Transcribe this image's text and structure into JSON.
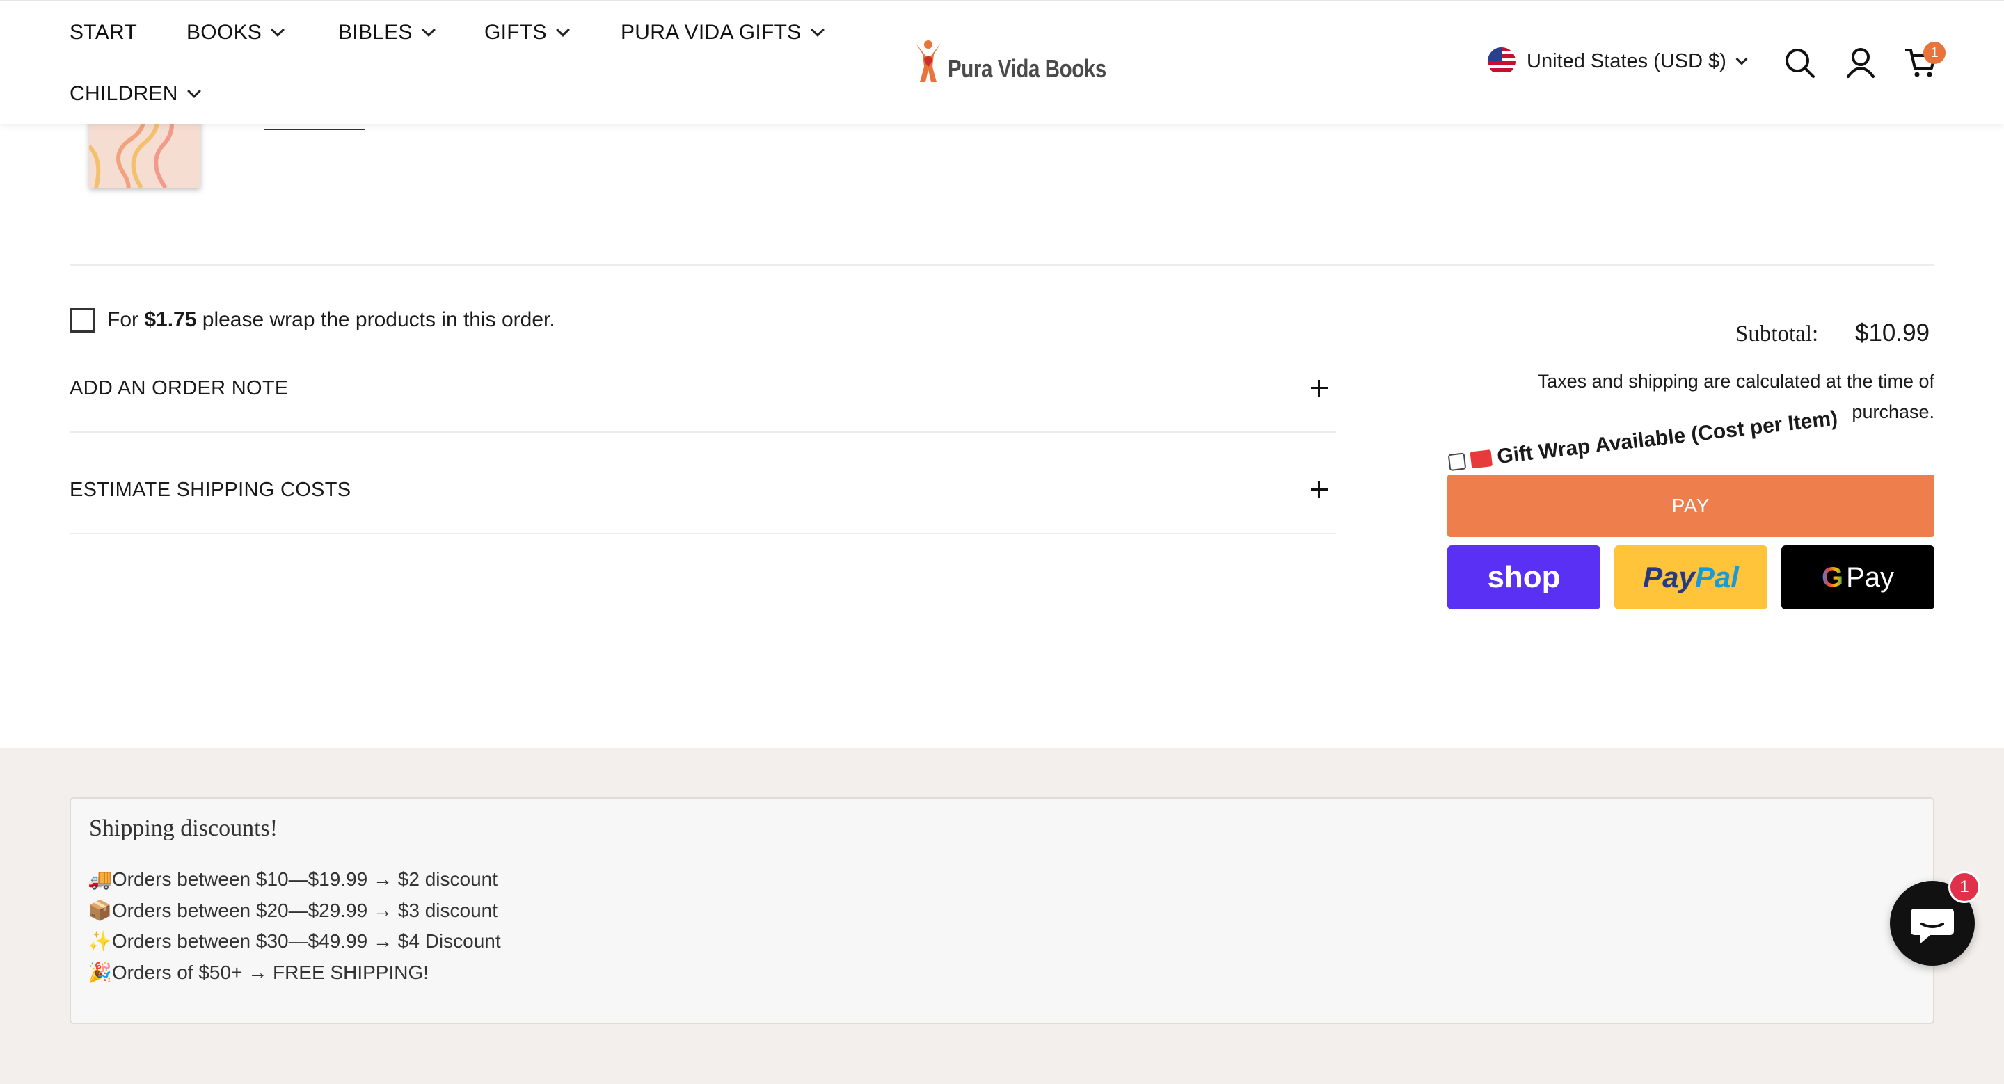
{
  "header": {
    "nav": [
      {
        "label": "START",
        "has_dropdown": false
      },
      {
        "label": "BOOKS",
        "has_dropdown": true
      },
      {
        "label": "BIBLES",
        "has_dropdown": true
      },
      {
        "label": "GIFTS",
        "has_dropdown": true
      },
      {
        "label": "PURA VIDA GIFTS",
        "has_dropdown": true
      },
      {
        "label": "CHILDREN",
        "has_dropdown": true
      }
    ],
    "logo_text": "Pura Vida Books",
    "locale": "United States (USD $)",
    "cart_count": "1",
    "icons": [
      "us-flag-icon",
      "chevron-down-icon",
      "search-icon",
      "account-icon",
      "cart-icon"
    ]
  },
  "cart": {
    "gift_wrap_prefix": "For ",
    "gift_wrap_price": "$1.75",
    "gift_wrap_suffix": " please wrap the products in this order.",
    "order_note_label": "ADD AN ORDER NOTE",
    "estimate_shipping_label": "ESTIMATE SHIPPING COSTS",
    "subtotal_label": "Subtotal:",
    "subtotal_value": "$10.99",
    "tax_note": "Taxes and shipping are calculated at the time of purchase.",
    "gift_wrap_available": "Gift Wrap Available (Cost per Item)",
    "pay_label": "PAY",
    "wallets": {
      "shop": "shop",
      "paypal": "PayPal",
      "gpay": "Pay"
    }
  },
  "shipping_discounts": {
    "title": "Shipping discounts!",
    "items": [
      {
        "icon": "🚚",
        "text": "Orders between $10—$19.99 → $2 discount"
      },
      {
        "icon": "📦",
        "text": "Orders between $20—$29.99 → $3 discount"
      },
      {
        "icon": "✨",
        "text": "Orders between $30—$49.99 → $4 Discount"
      },
      {
        "icon": "🎉",
        "text": "Orders of $50+ → FREE SHIPPING!"
      }
    ]
  },
  "chat": {
    "badge_count": "1"
  },
  "colors": {
    "accent": "#ee7f4c",
    "shop": "#5a31f4",
    "paypal": "#ffc439",
    "band": "#f3efec"
  }
}
